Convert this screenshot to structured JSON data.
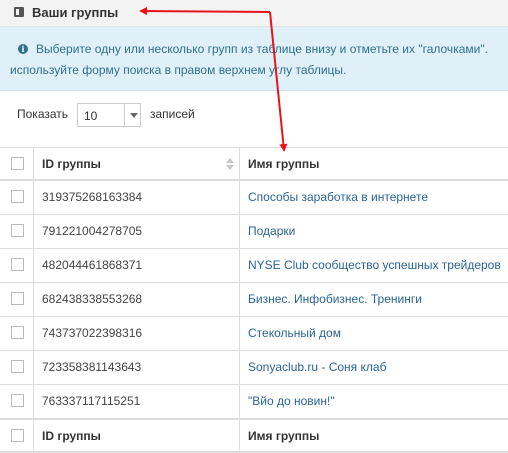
{
  "header": {
    "title": "Ваши группы",
    "icon": "table-icon"
  },
  "alert": {
    "icon": "info-icon",
    "line1": "Выберите одну или несколько групп из таблице внизу и отметьте их \"галочками\".",
    "line2": "используйте форму поиска в правом верхнем углу таблицы."
  },
  "length": {
    "label_before": "Показать",
    "value": "10",
    "label_after": "записей"
  },
  "table": {
    "columns": {
      "id": "ID группы",
      "name": "Имя группы"
    },
    "rows": [
      {
        "id": "319375268163384",
        "name": "Способы заработка в интернете"
      },
      {
        "id": "791221004278705",
        "name": "Подарки"
      },
      {
        "id": "482044461868371",
        "name": "NYSE Club сообщество успешных трейдеров"
      },
      {
        "id": "682438338553268",
        "name": "Бизнес. Инфобизнес. Тренинги"
      },
      {
        "id": "743737022398316",
        "name": "Стекольный дом"
      },
      {
        "id": "723358381143643",
        "name": "Sonyaclub.ru - Соня клаб"
      },
      {
        "id": "763337117115251",
        "name": "\"Вйо до новин!\""
      }
    ]
  },
  "colors": {
    "link": "#2a6496",
    "alert_bg": "#dff0f8",
    "alert_text": "#31708f",
    "arrow": "#e8141c"
  }
}
